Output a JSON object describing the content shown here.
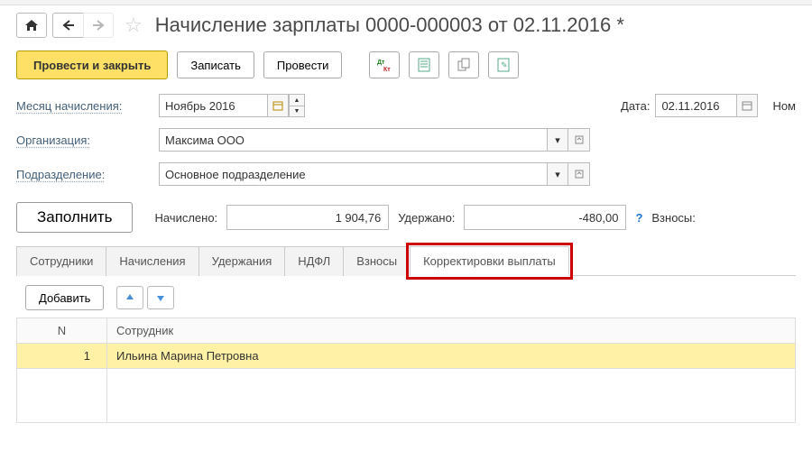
{
  "title": "Начисление зарплаты 0000-000003 от 02.11.2016 *",
  "toolbar": {
    "post_close": "Провести и закрыть",
    "save": "Записать",
    "post": "Провести"
  },
  "form": {
    "month_label": "Месяц начисления:",
    "month_value": "Ноябрь 2016",
    "date_label": "Дата:",
    "date_value": "02.11.2016",
    "number_label": "Ном",
    "org_label": "Организация:",
    "org_value": "Максима ООО",
    "dept_label": "Подразделение:",
    "dept_value": "Основное подразделение"
  },
  "totals": {
    "fill": "Заполнить",
    "accrued_label": "Начислено:",
    "accrued_value": "1 904,76",
    "withheld_label": "Удержано:",
    "withheld_value": "-480,00",
    "contrib_label": "Взносы:"
  },
  "tabs": [
    "Сотрудники",
    "Начисления",
    "Удержания",
    "НДФЛ",
    "Взносы",
    "Корректировки выплаты"
  ],
  "grid_toolbar": {
    "add": "Добавить"
  },
  "grid": {
    "col_n": "N",
    "col_emp": "Сотрудник",
    "rows": [
      {
        "n": "1",
        "emp": "Ильина Марина Петровна"
      }
    ]
  }
}
